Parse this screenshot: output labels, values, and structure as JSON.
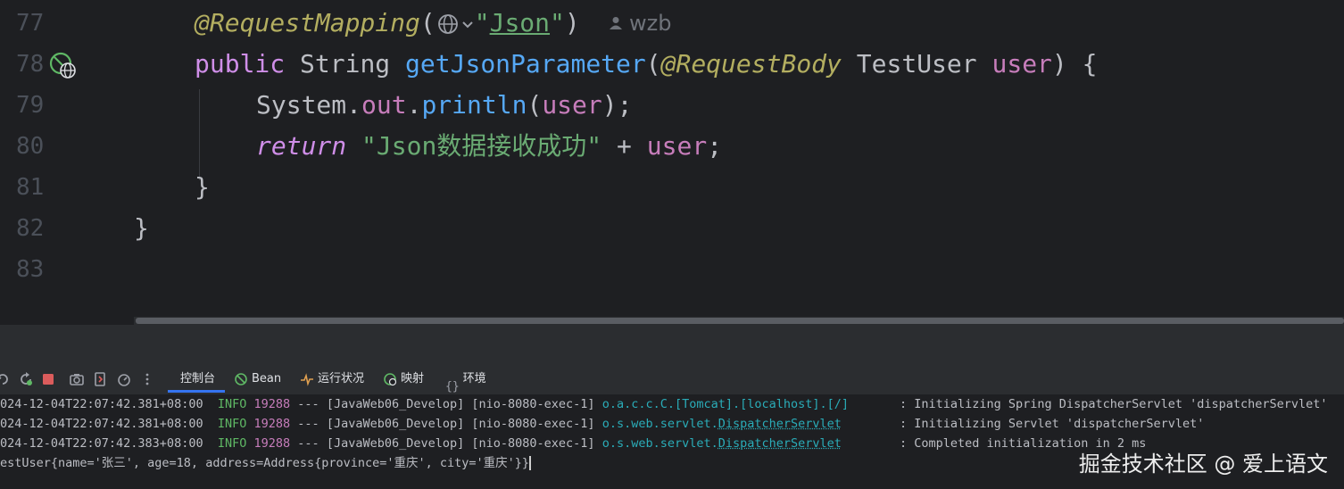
{
  "editor": {
    "line_numbers": [
      "77",
      "78",
      "79",
      "80",
      "81",
      "82",
      "83"
    ],
    "lines": {
      "l77": {
        "annotation": "@RequestMapping",
        "open_paren": "(",
        "quote_open": "\"",
        "string": "Json",
        "quote_close": "\"",
        "close_paren": ")"
      },
      "l78": {
        "kw": "public",
        "type": "String",
        "method": "getJsonParameter",
        "open_paren": "(",
        "annotation": "@RequestBody",
        "param_type": "TestUser",
        "param_name": "user",
        "close_paren": ")",
        "brace": "{"
      },
      "l79": {
        "class": "System",
        "dot1": ".",
        "field": "out",
        "dot2": ".",
        "method": "println",
        "open_paren": "(",
        "arg": "user",
        "close_paren": ")",
        "semi": ";"
      },
      "l80": {
        "kw": "return",
        "string": "\"Json数据接收成功\"",
        "op": "+",
        "var": "user",
        "semi": ";"
      },
      "l81": {
        "brace": "}"
      },
      "l82": {
        "brace": "}"
      }
    },
    "author": "wzb"
  },
  "toolbar": {
    "tabs": [
      {
        "label": "控制台",
        "icon": "console-icon",
        "active": true
      },
      {
        "label": "Bean",
        "icon": "bean-icon",
        "active": false
      },
      {
        "label": "运行状况",
        "icon": "health-icon",
        "active": false
      },
      {
        "label": "映射",
        "icon": "mappings-icon",
        "active": false
      },
      {
        "label": "环境",
        "icon": "environment-icon",
        "active": false
      }
    ]
  },
  "console": {
    "logs": [
      {
        "ts": "024-12-04T22:07:42.381+08:00",
        "level": "INFO",
        "pid": "19288",
        "sep": "---",
        "app": "[JavaWeb06_Develop]",
        "thread": "[nio-8080-exec-1]",
        "logger_prefix": "o.a.c.c.C.[Tomcat].[localhost].[/]",
        "logger_link": "",
        "message": ": Initializing Spring DispatcherServlet 'dispatcherServlet'"
      },
      {
        "ts": "024-12-04T22:07:42.381+08:00",
        "level": "INFO",
        "pid": "19288",
        "sep": "---",
        "app": "[JavaWeb06_Develop]",
        "thread": "[nio-8080-exec-1]",
        "logger_prefix": "o.s.web.servlet.",
        "logger_link": "DispatcherServlet",
        "message": ": Initializing Servlet 'dispatcherServlet'"
      },
      {
        "ts": "024-12-04T22:07:42.383+08:00",
        "level": "INFO",
        "pid": "19288",
        "sep": "---",
        "app": "[JavaWeb06_Develop]",
        "thread": "[nio-8080-exec-1]",
        "logger_prefix": "o.s.web.servlet.",
        "logger_link": "DispatcherServlet",
        "message": ": Completed initialization in 2 ms"
      }
    ],
    "output_line": "estUser{name='张三', age=18, address=Address{province='重庆', city='重庆'}}"
  },
  "watermark": "掘金技术社区 @ 爱上语文",
  "colors": {
    "background": "#1e1f22",
    "panel": "#2b2d30",
    "accent": "#3574f0"
  }
}
